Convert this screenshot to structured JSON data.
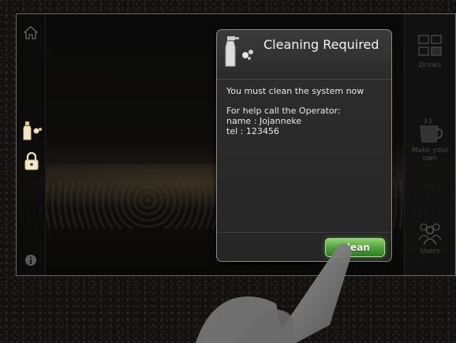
{
  "sidebar_left": {
    "home_icon": "home-icon",
    "cleaning_icon": "cleaning-spray-icon",
    "lock_icon": "lock-icon",
    "info_icon": "info-icon"
  },
  "sidebar_right": {
    "items": [
      {
        "label": "Drinks",
        "icon": "cups-icon"
      },
      {
        "label": "Make your own",
        "icon": "coffee-machine-icon"
      },
      {
        "label": "Users",
        "icon": "users-icon"
      }
    ]
  },
  "dialog": {
    "title": "Cleaning Required",
    "message": "You must clean the system now",
    "help_line": "For help call the Operator:",
    "name_line": "name : Jojanneke",
    "tel_line": "tel : 123456",
    "button_label": "Clean"
  },
  "colors": {
    "button_green": "#4fa43a",
    "accent_gold": "#e9c66a",
    "dialog_bg": "#2c2c2c"
  }
}
